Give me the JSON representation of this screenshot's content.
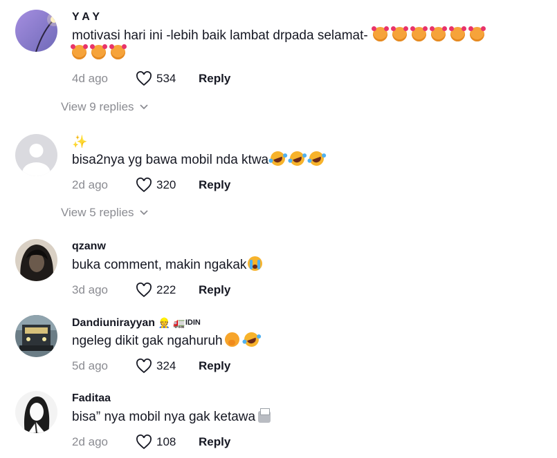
{
  "comments": [
    {
      "username": "Y A Y",
      "text": "motivasi hari ini -lebih baik lambat drpada selamat-",
      "date": "4d ago",
      "likes": "534",
      "reply_label": "Reply",
      "view_replies": "View 9 replies",
      "avatar_color": "#8b7cc9"
    },
    {
      "username": "",
      "username_icon": "sparkles-icon",
      "text": "bisa2nya yg bawa mobil nda ktwa",
      "date": "2d ago",
      "likes": "320",
      "reply_label": "Reply",
      "view_replies": "View 5 replies",
      "avatar_color": "#d9d9dd"
    },
    {
      "username": "qzanw",
      "text": "buka comment, makin ngakak",
      "date": "3d ago",
      "likes": "222",
      "reply_label": "Reply",
      "avatar_color": "#2a2623"
    },
    {
      "username": "Dandiunirayyan",
      "username_badge": "IDIN",
      "text": "ngeleg dikit gak ngahuruh",
      "date": "5d ago",
      "likes": "324",
      "reply_label": "Reply",
      "avatar_color": "#3d4a53"
    },
    {
      "username": "Faditaa",
      "text": "bisa” nya mobil nya gak ketawa",
      "date": "2d ago",
      "likes": "108",
      "reply_label": "Reply",
      "avatar_color": "#e8e8e8"
    }
  ],
  "colors": {
    "text": "#161823",
    "secondary": "#8a8b91",
    "background": "#ffffff"
  }
}
